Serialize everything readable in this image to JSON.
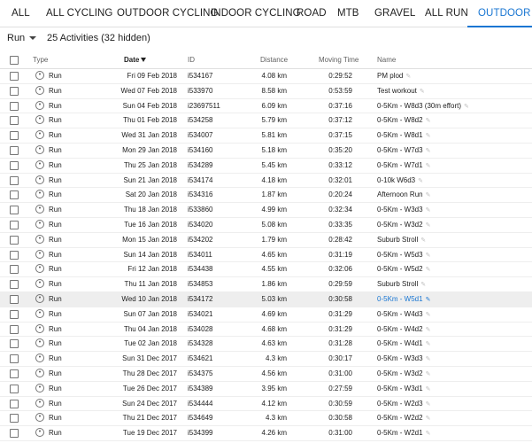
{
  "tabs": [
    {
      "label": "ALL",
      "active": false
    },
    {
      "label": "ALL CYCLING",
      "active": false
    },
    {
      "label": "OUTDOOR CYCLING",
      "active": false
    },
    {
      "label": "INDOOR CYCLING",
      "active": false
    },
    {
      "label": "ROAD",
      "active": false
    },
    {
      "label": "MTB",
      "active": false
    },
    {
      "label": "GRAVEL",
      "active": false
    },
    {
      "label": "ALL RUN",
      "active": false
    },
    {
      "label": "OUTDOOR RUN",
      "active": true
    }
  ],
  "filter": {
    "type_label": "Run",
    "count_text": "25 Activities (32 hidden)"
  },
  "columns": {
    "type": "Type",
    "date": "Date",
    "id": "ID",
    "distance": "Distance",
    "moving_time": "Moving Time",
    "name": "Name"
  },
  "icons": {
    "run": "run-icon",
    "edit": "pencil-icon",
    "caret": "chevron-down-icon",
    "sort": "sort-desc-icon"
  },
  "accent_color": "#1976d2",
  "rows": [
    {
      "type": "Run",
      "date": "Fri 09 Feb 2018",
      "id": "i534167",
      "distance": "4.08 km",
      "time": "0:29:52",
      "name": "PM plod"
    },
    {
      "type": "Run",
      "date": "Wed 07 Feb 2018",
      "id": "i533970",
      "distance": "8.58 km",
      "time": "0:53:59",
      "name": "Test workout"
    },
    {
      "type": "Run",
      "date": "Sun 04 Feb 2018",
      "id": "i23697511",
      "distance": "6.09 km",
      "time": "0:37:16",
      "name": "0-5Km - W8d3 (30m effort)"
    },
    {
      "type": "Run",
      "date": "Thu 01 Feb 2018",
      "id": "i534258",
      "distance": "5.79 km",
      "time": "0:37:12",
      "name": "0-5Km - W8d2"
    },
    {
      "type": "Run",
      "date": "Wed 31 Jan 2018",
      "id": "i534007",
      "distance": "5.81 km",
      "time": "0:37:15",
      "name": "0-5Km - W8d1"
    },
    {
      "type": "Run",
      "date": "Mon 29 Jan 2018",
      "id": "i534160",
      "distance": "5.18 km",
      "time": "0:35:20",
      "name": "0-5Km - W7d3"
    },
    {
      "type": "Run",
      "date": "Thu 25 Jan 2018",
      "id": "i534289",
      "distance": "5.45 km",
      "time": "0:33:12",
      "name": "0-5Km - W7d1"
    },
    {
      "type": "Run",
      "date": "Sun 21 Jan 2018",
      "id": "i534174",
      "distance": "4.18 km",
      "time": "0:32:01",
      "name": "0-10k W6d3"
    },
    {
      "type": "Run",
      "date": "Sat 20 Jan 2018",
      "id": "i534316",
      "distance": "1.87 km",
      "time": "0:20:24",
      "name": "Afternoon Run"
    },
    {
      "type": "Run",
      "date": "Thu 18 Jan 2018",
      "id": "i533860",
      "distance": "4.99 km",
      "time": "0:32:34",
      "name": "0-5Km - W3d3"
    },
    {
      "type": "Run",
      "date": "Tue 16 Jan 2018",
      "id": "i534020",
      "distance": "5.08 km",
      "time": "0:33:35",
      "name": "0-5Km - W3d2"
    },
    {
      "type": "Run",
      "date": "Mon 15 Jan 2018",
      "id": "i534202",
      "distance": "1.79 km",
      "time": "0:28:42",
      "name": "Suburb Stroll"
    },
    {
      "type": "Run",
      "date": "Sun 14 Jan 2018",
      "id": "i534011",
      "distance": "4.65 km",
      "time": "0:31:19",
      "name": "0-5Km - W5d3"
    },
    {
      "type": "Run",
      "date": "Fri 12 Jan 2018",
      "id": "i534438",
      "distance": "4.55 km",
      "time": "0:32:06",
      "name": "0-5Km - W5d2"
    },
    {
      "type": "Run",
      "date": "Thu 11 Jan 2018",
      "id": "i534853",
      "distance": "1.86 km",
      "time": "0:29:59",
      "name": "Suburb Stroll"
    },
    {
      "type": "Run",
      "date": "Wed 10 Jan 2018",
      "id": "i534172",
      "distance": "5.03 km",
      "time": "0:30:58",
      "name": "0-5Km - W5d1"
    },
    {
      "type": "Run",
      "date": "Sun 07 Jan 2018",
      "id": "i534021",
      "distance": "4.69 km",
      "time": "0:31:29",
      "name": "0-5Km - W4d3"
    },
    {
      "type": "Run",
      "date": "Thu 04 Jan 2018",
      "id": "i534028",
      "distance": "4.68 km",
      "time": "0:31:29",
      "name": "0-5Km - W4d2"
    },
    {
      "type": "Run",
      "date": "Tue 02 Jan 2018",
      "id": "i534328",
      "distance": "4.63 km",
      "time": "0:31:28",
      "name": "0-5Km - W4d1"
    },
    {
      "type": "Run",
      "date": "Sun 31 Dec 2017",
      "id": "i534621",
      "distance": "4.3 km",
      "time": "0:30:17",
      "name": "0-5Km - W3d3"
    },
    {
      "type": "Run",
      "date": "Thu 28 Dec 2017",
      "id": "i534375",
      "distance": "4.56 km",
      "time": "0:31:00",
      "name": "0-5Km - W3d2"
    },
    {
      "type": "Run",
      "date": "Tue 26 Dec 2017",
      "id": "i534389",
      "distance": "3.95 km",
      "time": "0:27:59",
      "name": "0-5Km - W3d1"
    },
    {
      "type": "Run",
      "date": "Sun 24 Dec 2017",
      "id": "i534444",
      "distance": "4.12 km",
      "time": "0:30:59",
      "name": "0-5Km - W2d3"
    },
    {
      "type": "Run",
      "date": "Thu 21 Dec 2017",
      "id": "i534649",
      "distance": "4.3 km",
      "time": "0:30:58",
      "name": "0-5Km - W2d2"
    },
    {
      "type": "Run",
      "date": "Tue 19 Dec 2017",
      "id": "i534399",
      "distance": "4.26 km",
      "time": "0:31:00",
      "name": "0-5Km - W2d1"
    }
  ]
}
